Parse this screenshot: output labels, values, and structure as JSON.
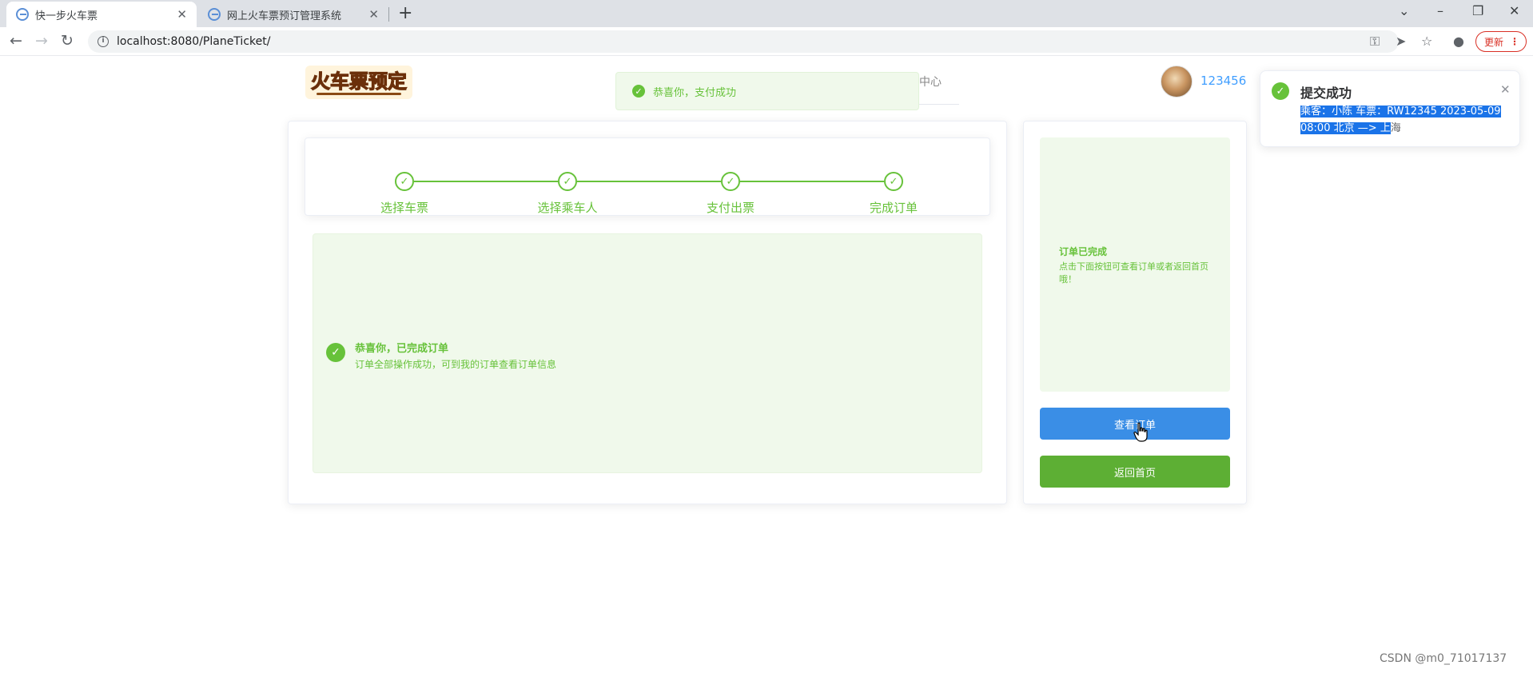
{
  "browser": {
    "tabs": [
      {
        "title": "快一步火车票",
        "close": "✕"
      },
      {
        "title": "网上火车票预订管理系统",
        "close": "✕"
      }
    ],
    "new_tab": "+",
    "address": "localhost:8080/PlaneTicket/",
    "update_label": "更新",
    "menu_dots": "⋮"
  },
  "header": {
    "logo_text": "火车票预定",
    "nav_fragment": "中心",
    "username": "123456"
  },
  "top_message": {
    "text": "恭喜你，支付成功"
  },
  "steps": [
    {
      "label": "选择车票"
    },
    {
      "label": "选择乘车人"
    },
    {
      "label": "支付出票"
    },
    {
      "label": "完成订单"
    }
  ],
  "result": {
    "title": "恭喜你，已完成订单",
    "description": "订单全部操作成功，可到我的订单查看订单信息"
  },
  "side": {
    "title": "订单已完成",
    "description": "点击下面按钮可查看订单或者返回首页哦！",
    "view_order_button": "查看订单",
    "home_button": "返回首页"
  },
  "notification": {
    "title": "提交成功",
    "message_selected": "乘客：小陈 车票：RW12345 2023-05-09 08:00 北京 —> 上",
    "message_rest": "海"
  },
  "watermark": "CSDN @m0_71017137",
  "colors": {
    "success_green": "#67c23a",
    "primary_blue": "#3a8ee6",
    "button_green": "#5daf34",
    "panel_bg": "#f0f9eb"
  }
}
